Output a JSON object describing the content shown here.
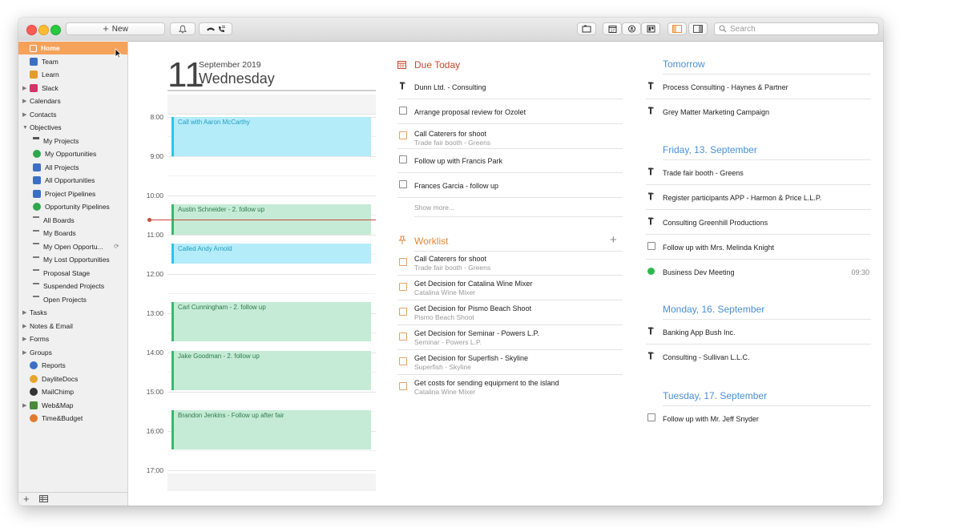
{
  "toolbar": {
    "new_label": "New",
    "search_placeholder": "Search"
  },
  "sidebar": {
    "items": [
      {
        "label": "Home",
        "icon": "home-icon",
        "color": "#ffffff",
        "expandable": false,
        "indent": 0,
        "selected": true
      },
      {
        "label": "Team",
        "icon": "team-icon",
        "color": "#3b6fc4",
        "expandable": false,
        "indent": 0
      },
      {
        "label": "Learn",
        "icon": "learn-icon",
        "color": "#e59a2e",
        "expandable": false,
        "indent": 0
      },
      {
        "label": "Slack",
        "icon": "slack-icon",
        "color": "#d6336c",
        "expandable": true,
        "indent": 0
      },
      {
        "label": "Calendars",
        "icon": "",
        "color": "",
        "expandable": true,
        "indent": 0
      },
      {
        "label": "Contacts",
        "icon": "",
        "color": "",
        "expandable": true,
        "indent": 0
      },
      {
        "label": "Objectives",
        "icon": "",
        "color": "",
        "expandable": true,
        "expanded": true,
        "indent": 0
      },
      {
        "label": "My Projects",
        "icon": "hammer-icon",
        "color": "#555555",
        "expandable": false,
        "indent": 1
      },
      {
        "label": "My Opportunities",
        "icon": "dollar-icon",
        "color": "#2ea84a",
        "expandable": false,
        "indent": 1
      },
      {
        "label": "All Projects",
        "icon": "projects-list-icon",
        "color": "#3b6fc4",
        "expandable": false,
        "indent": 1
      },
      {
        "label": "All Opportunities",
        "icon": "opportunities-list-icon",
        "color": "#3b6fc4",
        "expandable": false,
        "indent": 1
      },
      {
        "label": "Project Pipelines",
        "icon": "pipeline-icon",
        "color": "#3b6fc4",
        "expandable": false,
        "indent": 1
      },
      {
        "label": "Opportunity Pipelines",
        "icon": "pipeline-icon",
        "color": "#2ea84a",
        "expandable": false,
        "indent": 1
      },
      {
        "label": "All Boards",
        "icon": "board-icon",
        "color": "#777777",
        "expandable": false,
        "indent": 1
      },
      {
        "label": "My Boards",
        "icon": "board-icon",
        "color": "#777777",
        "expandable": false,
        "indent": 1
      },
      {
        "label": "My Open Opportu...",
        "icon": "smart-list-icon",
        "color": "#777777",
        "expandable": false,
        "indent": 1,
        "badge": "sync-icon"
      },
      {
        "label": "My Lost Opportunities",
        "icon": "smart-list-icon",
        "color": "#777777",
        "expandable": false,
        "indent": 1
      },
      {
        "label": "Proposal Stage",
        "icon": "smart-list-icon",
        "color": "#777777",
        "expandable": false,
        "indent": 1
      },
      {
        "label": "Suspended Projects",
        "icon": "board-icon",
        "color": "#777777",
        "expandable": false,
        "indent": 1
      },
      {
        "label": "Open Projects",
        "icon": "board-icon",
        "color": "#777777",
        "expandable": false,
        "indent": 1
      },
      {
        "label": "Tasks",
        "icon": "",
        "color": "",
        "expandable": true,
        "indent": 0
      },
      {
        "label": "Notes & Email",
        "icon": "",
        "color": "",
        "expandable": true,
        "indent": 0
      },
      {
        "label": "Forms",
        "icon": "",
        "color": "",
        "expandable": true,
        "indent": 0
      },
      {
        "label": "Groups",
        "icon": "",
        "color": "",
        "expandable": true,
        "indent": 0
      },
      {
        "label": "Reports",
        "icon": "reports-icon",
        "color": "#3b6fc4",
        "expandable": false,
        "indent": 0
      },
      {
        "label": "DayliteDocs",
        "icon": "daylitedocs-icon",
        "color": "#e5a52e",
        "expandable": false,
        "indent": 0
      },
      {
        "label": "MailChimp",
        "icon": "mailchimp-icon",
        "color": "#333333",
        "expandable": false,
        "indent": 0
      },
      {
        "label": "Web&Map",
        "icon": "webmap-icon",
        "color": "#4a8a3a",
        "expandable": true,
        "indent": 0
      },
      {
        "label": "Time&Budget",
        "icon": "timebudget-icon",
        "color": "#e07a2e",
        "expandable": false,
        "indent": 0
      }
    ]
  },
  "calendar": {
    "day": "11",
    "month_year": "September 2019",
    "weekday": "Wednesday",
    "hours": [
      "8:00",
      "9:00",
      "10:00",
      "11:00",
      "12:00",
      "13:00",
      "14:00",
      "15:00",
      "16:00",
      "17:00"
    ],
    "events": [
      {
        "title": "Call with Aaron McCarthy",
        "kind": "call"
      },
      {
        "title": "Austin Schneider - 2. follow up",
        "kind": "meeting"
      },
      {
        "title": "Called Andy Arnold",
        "kind": "call"
      },
      {
        "title": "Carl Cunningham - 2. follow up",
        "kind": "meeting"
      },
      {
        "title": "Jake Goodman - 2. follow up",
        "kind": "meeting"
      },
      {
        "title": "Brandon Jenkins - Follow up after fair",
        "kind": "meeting"
      }
    ],
    "colors": {
      "call_bg": "#b5ecfa",
      "call_bar": "#2fc3e8",
      "call_text": "#1e9ec0",
      "meeting_bg": "#c5ebd6",
      "meeting_bar": "#3cb66c",
      "meeting_text": "#2f7a4c",
      "now_line": "#c94a3a"
    }
  },
  "due_today": {
    "title": "Due Today",
    "color": "#c8482f",
    "items": [
      {
        "title": "Dunn Ltd. - Consulting",
        "sub": "",
        "icon": "hammer-icon"
      },
      {
        "title": "Arrange proposal review for Ozolet",
        "sub": "",
        "icon": "checkbox"
      },
      {
        "title": "Call Caterers for shoot",
        "sub": "Trade fair booth - Greens",
        "icon": "checkbox-orange"
      },
      {
        "title": "Follow up with Francis Park",
        "sub": "",
        "icon": "checkbox"
      },
      {
        "title": "Frances Garcia - follow up",
        "sub": "",
        "icon": "checkbox"
      }
    ],
    "show_more": "Show more..."
  },
  "worklist": {
    "title": "Worklist",
    "color": "#e0893a",
    "items": [
      {
        "title": "Call Caterers for shoot",
        "sub": "Trade fair booth - Greens"
      },
      {
        "title": "Get Decision for Catalina Wine Mixer",
        "sub": "Catalina Wine Mixer"
      },
      {
        "title": "Get Decision for Pismo Beach Shoot",
        "sub": "Pismo Beach Shoot"
      },
      {
        "title": "Get Decision for Seminar - Powers L.P.",
        "sub": "Seminar - Powers L.P."
      },
      {
        "title": "Get Decision for Superfish - Skyline",
        "sub": "Superfish - Skyline"
      },
      {
        "title": "Get costs for sending equipment to the island",
        "sub": "Catalina Wine Mixer"
      }
    ]
  },
  "upcoming": {
    "color": "#4a8fd6",
    "sections": [
      {
        "title": "Tomorrow",
        "items": [
          {
            "title": "Process Consulting - Haynes & Partner",
            "icon": "hammer-icon",
            "time": ""
          },
          {
            "title": "Grey Matter Marketing Campaign",
            "icon": "hammer-icon",
            "time": ""
          }
        ]
      },
      {
        "title": "Friday, 13. September",
        "items": [
          {
            "title": "Trade fair booth - Greens",
            "icon": "hammer-icon",
            "time": ""
          },
          {
            "title": "Register participants APP - Harmon & Price L.L.P.",
            "icon": "hammer-icon",
            "time": ""
          },
          {
            "title": "Consulting Greenhill Productions",
            "icon": "hammer-icon",
            "time": ""
          },
          {
            "title": "Follow up with Mrs. Melinda Knight",
            "icon": "checkbox",
            "time": ""
          },
          {
            "title": "Business Dev Meeting",
            "icon": "green-dot",
            "time": "09:30"
          }
        ]
      },
      {
        "title": "Monday, 16. September",
        "items": [
          {
            "title": "Banking App Bush Inc.",
            "icon": "hammer-icon",
            "time": ""
          },
          {
            "title": "Consulting - Sullivan L.L.C.",
            "icon": "hammer-icon",
            "time": ""
          }
        ]
      },
      {
        "title": "Tuesday, 17. September",
        "items": [
          {
            "title": "Follow up with Mr. Jeff Snyder",
            "icon": "checkbox",
            "time": ""
          }
        ]
      }
    ]
  }
}
